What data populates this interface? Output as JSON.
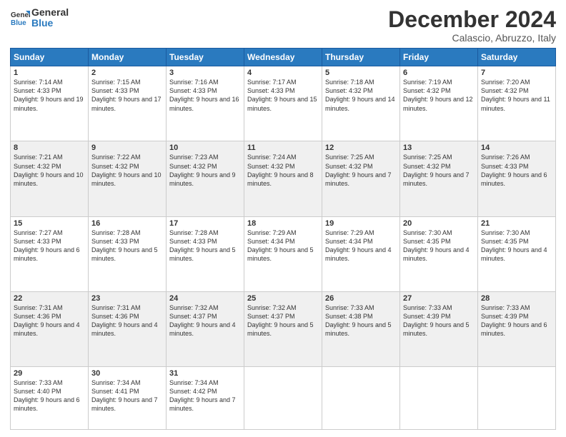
{
  "header": {
    "logo_line1": "General",
    "logo_line2": "Blue",
    "month": "December 2024",
    "location": "Calascio, Abruzzo, Italy"
  },
  "days_of_week": [
    "Sunday",
    "Monday",
    "Tuesday",
    "Wednesday",
    "Thursday",
    "Friday",
    "Saturday"
  ],
  "weeks": [
    [
      {
        "day": "1",
        "sunrise": "7:14 AM",
        "sunset": "4:33 PM",
        "daylight": "9 hours and 19 minutes."
      },
      {
        "day": "2",
        "sunrise": "7:15 AM",
        "sunset": "4:33 PM",
        "daylight": "9 hours and 17 minutes."
      },
      {
        "day": "3",
        "sunrise": "7:16 AM",
        "sunset": "4:33 PM",
        "daylight": "9 hours and 16 minutes."
      },
      {
        "day": "4",
        "sunrise": "7:17 AM",
        "sunset": "4:33 PM",
        "daylight": "9 hours and 15 minutes."
      },
      {
        "day": "5",
        "sunrise": "7:18 AM",
        "sunset": "4:32 PM",
        "daylight": "9 hours and 14 minutes."
      },
      {
        "day": "6",
        "sunrise": "7:19 AM",
        "sunset": "4:32 PM",
        "daylight": "9 hours and 12 minutes."
      },
      {
        "day": "7",
        "sunrise": "7:20 AM",
        "sunset": "4:32 PM",
        "daylight": "9 hours and 11 minutes."
      }
    ],
    [
      {
        "day": "8",
        "sunrise": "7:21 AM",
        "sunset": "4:32 PM",
        "daylight": "9 hours and 10 minutes."
      },
      {
        "day": "9",
        "sunrise": "7:22 AM",
        "sunset": "4:32 PM",
        "daylight": "9 hours and 10 minutes."
      },
      {
        "day": "10",
        "sunrise": "7:23 AM",
        "sunset": "4:32 PM",
        "daylight": "9 hours and 9 minutes."
      },
      {
        "day": "11",
        "sunrise": "7:24 AM",
        "sunset": "4:32 PM",
        "daylight": "9 hours and 8 minutes."
      },
      {
        "day": "12",
        "sunrise": "7:25 AM",
        "sunset": "4:32 PM",
        "daylight": "9 hours and 7 minutes."
      },
      {
        "day": "13",
        "sunrise": "7:25 AM",
        "sunset": "4:32 PM",
        "daylight": "9 hours and 7 minutes."
      },
      {
        "day": "14",
        "sunrise": "7:26 AM",
        "sunset": "4:33 PM",
        "daylight": "9 hours and 6 minutes."
      }
    ],
    [
      {
        "day": "15",
        "sunrise": "7:27 AM",
        "sunset": "4:33 PM",
        "daylight": "9 hours and 6 minutes."
      },
      {
        "day": "16",
        "sunrise": "7:28 AM",
        "sunset": "4:33 PM",
        "daylight": "9 hours and 5 minutes."
      },
      {
        "day": "17",
        "sunrise": "7:28 AM",
        "sunset": "4:33 PM",
        "daylight": "9 hours and 5 minutes."
      },
      {
        "day": "18",
        "sunrise": "7:29 AM",
        "sunset": "4:34 PM",
        "daylight": "9 hours and 5 minutes."
      },
      {
        "day": "19",
        "sunrise": "7:29 AM",
        "sunset": "4:34 PM",
        "daylight": "9 hours and 4 minutes."
      },
      {
        "day": "20",
        "sunrise": "7:30 AM",
        "sunset": "4:35 PM",
        "daylight": "9 hours and 4 minutes."
      },
      {
        "day": "21",
        "sunrise": "7:30 AM",
        "sunset": "4:35 PM",
        "daylight": "9 hours and 4 minutes."
      }
    ],
    [
      {
        "day": "22",
        "sunrise": "7:31 AM",
        "sunset": "4:36 PM",
        "daylight": "9 hours and 4 minutes."
      },
      {
        "day": "23",
        "sunrise": "7:31 AM",
        "sunset": "4:36 PM",
        "daylight": "9 hours and 4 minutes."
      },
      {
        "day": "24",
        "sunrise": "7:32 AM",
        "sunset": "4:37 PM",
        "daylight": "9 hours and 4 minutes."
      },
      {
        "day": "25",
        "sunrise": "7:32 AM",
        "sunset": "4:37 PM",
        "daylight": "9 hours and 5 minutes."
      },
      {
        "day": "26",
        "sunrise": "7:33 AM",
        "sunset": "4:38 PM",
        "daylight": "9 hours and 5 minutes."
      },
      {
        "day": "27",
        "sunrise": "7:33 AM",
        "sunset": "4:39 PM",
        "daylight": "9 hours and 5 minutes."
      },
      {
        "day": "28",
        "sunrise": "7:33 AM",
        "sunset": "4:39 PM",
        "daylight": "9 hours and 6 minutes."
      }
    ],
    [
      {
        "day": "29",
        "sunrise": "7:33 AM",
        "sunset": "4:40 PM",
        "daylight": "9 hours and 6 minutes."
      },
      {
        "day": "30",
        "sunrise": "7:34 AM",
        "sunset": "4:41 PM",
        "daylight": "9 hours and 7 minutes."
      },
      {
        "day": "31",
        "sunrise": "7:34 AM",
        "sunset": "4:42 PM",
        "daylight": "9 hours and 7 minutes."
      },
      null,
      null,
      null,
      null
    ]
  ]
}
